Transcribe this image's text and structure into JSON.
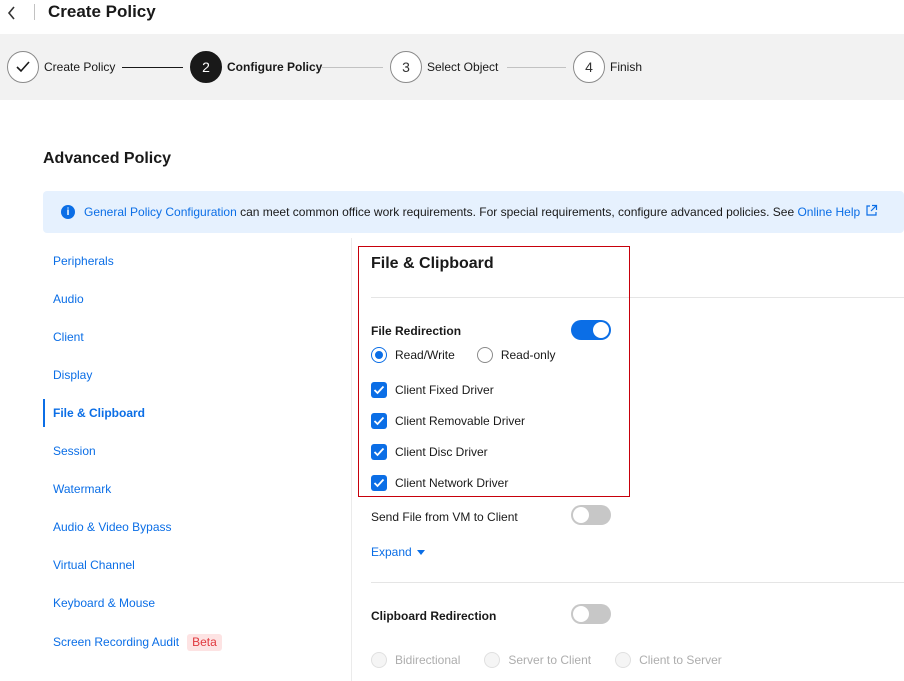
{
  "header": {
    "title": "Create Policy"
  },
  "steps": [
    {
      "number": "",
      "label": "Create Policy",
      "state": "done"
    },
    {
      "number": "2",
      "label": "Configure Policy",
      "state": "active"
    },
    {
      "number": "3",
      "label": "Select Object",
      "state": "pending"
    },
    {
      "number": "4",
      "label": "Finish",
      "state": "pending"
    }
  ],
  "section": {
    "title": "Advanced Policy"
  },
  "banner": {
    "link_text": "General Policy Configuration",
    "text": " can meet common office work requirements. For special requirements, configure advanced policies. See ",
    "help_link": "Online Help"
  },
  "nav": {
    "items": [
      {
        "label": "Peripherals"
      },
      {
        "label": "Audio"
      },
      {
        "label": "Client"
      },
      {
        "label": "Display"
      },
      {
        "label": "File & Clipboard",
        "active": true
      },
      {
        "label": "Session"
      },
      {
        "label": "Watermark"
      },
      {
        "label": "Audio & Video Bypass"
      },
      {
        "label": "Virtual Channel"
      },
      {
        "label": "Keyboard & Mouse"
      },
      {
        "label": "Screen Recording Audit",
        "badge": "Beta"
      }
    ]
  },
  "panel": {
    "title": "File & Clipboard",
    "file_redirection": {
      "label": "File Redirection",
      "enabled": true,
      "mode_options": [
        "Read/Write",
        "Read-only"
      ],
      "mode_selected": "Read/Write",
      "drivers": [
        {
          "label": "Client Fixed Driver",
          "checked": true
        },
        {
          "label": "Client Removable Driver",
          "checked": true
        },
        {
          "label": "Client Disc Driver",
          "checked": true
        },
        {
          "label": "Client Network Driver",
          "checked": true
        }
      ]
    },
    "send_file": {
      "label": "Send File from VM to Client",
      "enabled": false
    },
    "expand_label": "Expand",
    "clipboard_redirection": {
      "label": "Clipboard Redirection",
      "enabled": false,
      "options": [
        "Bidirectional",
        "Server to Client",
        "Client to Server"
      ]
    }
  },
  "colors": {
    "accent": "#0b6ee6",
    "highlight_border": "#c7000b",
    "banner_bg": "#e6f1fe"
  }
}
